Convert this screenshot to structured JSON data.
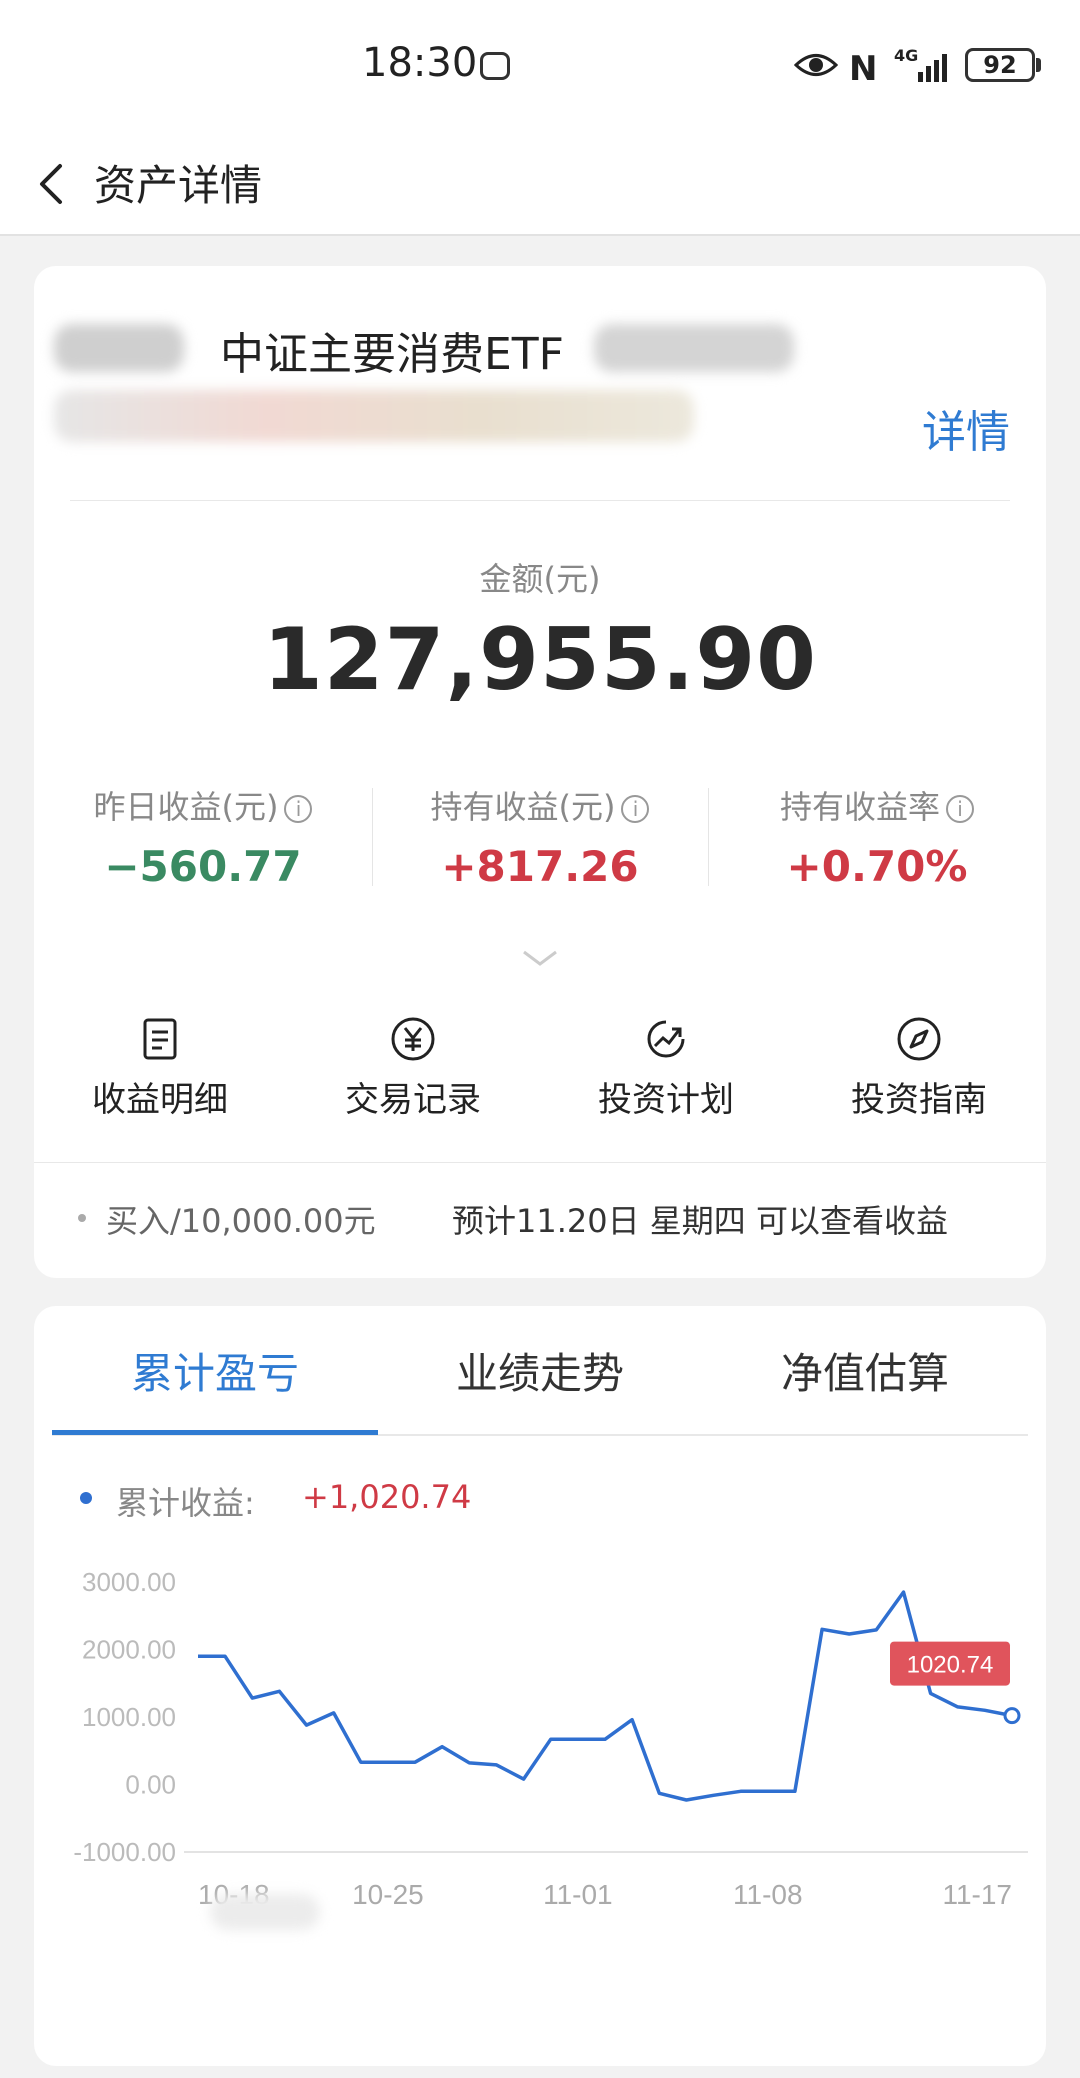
{
  "status_bar": {
    "time": "18:30",
    "battery": "92",
    "network": "4G"
  },
  "header": {
    "title": "资产详情"
  },
  "fund": {
    "name": "中证主要消费ETF",
    "detail_link": "详情"
  },
  "amount": {
    "label": "金额(元)",
    "value": "127,955.90"
  },
  "stats": [
    {
      "label": "昨日收益(元)",
      "value": "−560.77"
    },
    {
      "label": "持有收益(元)",
      "value": "+817.26"
    },
    {
      "label": "持有收益率",
      "value": "+0.70%"
    }
  ],
  "actions": [
    {
      "label": "收益明细",
      "icon": "document-icon"
    },
    {
      "label": "交易记录",
      "icon": "yuan-icon"
    },
    {
      "label": "投资计划",
      "icon": "trend-icon"
    },
    {
      "label": "投资指南",
      "icon": "compass-icon"
    }
  ],
  "purchase": {
    "text": "买入/10,000.00元",
    "expect": "预计11.20日 星期四 可以查看收益"
  },
  "tabs": [
    {
      "label": "累计盈亏",
      "active": true
    },
    {
      "label": "业绩走势",
      "active": false
    },
    {
      "label": "净值估算",
      "active": false
    }
  ],
  "legend": {
    "label": "累计收益:",
    "value": "+1,020.74"
  },
  "colors": {
    "accent": "#2f7bd2",
    "positive": "#cf3a45",
    "negative": "#3a8a62",
    "line": "#2f6fd0"
  },
  "chart_data": {
    "type": "line",
    "x": [
      "10-18",
      "10-19",
      "10-20",
      "10-21",
      "10-22",
      "10-23",
      "10-24",
      "10-25",
      "10-26",
      "10-27",
      "10-28",
      "10-29",
      "10-30",
      "10-31",
      "11-01",
      "11-02",
      "11-03",
      "11-04",
      "11-05",
      "11-06",
      "11-07",
      "11-08",
      "11-09",
      "11-10",
      "11-11",
      "11-12",
      "11-13",
      "11-14",
      "11-15",
      "11-16",
      "11-17"
    ],
    "series": [
      {
        "values": [
          1900,
          1900,
          1280,
          1380,
          880,
          1060,
          330,
          330,
          330,
          560,
          320,
          290,
          80,
          670,
          670,
          670,
          960,
          -130,
          -230,
          -160,
          -100,
          -100,
          -100,
          2300,
          2230,
          2290,
          2850,
          1350,
          1150,
          1100,
          1020.74
        ]
      }
    ],
    "ylim": [
      -1000,
      3000
    ],
    "yticks": [
      "3000.00",
      "2000.00",
      "1000.00",
      "0.00",
      "-1000.00"
    ],
    "xticks": [
      "10-18",
      "10-25",
      "11-01",
      "11-08",
      "11-17"
    ],
    "last_label": "1020.74",
    "grid": false
  }
}
